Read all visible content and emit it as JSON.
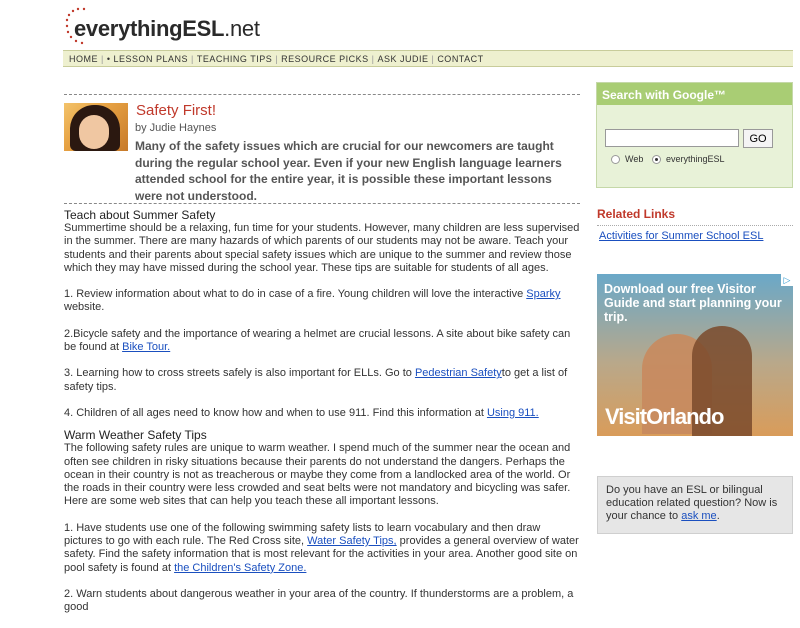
{
  "site": {
    "name_bold": "everythingESL",
    "name_suffix": ".net"
  },
  "nav": {
    "items": [
      "HOME",
      "• LESSON PLANS",
      "TEACHING TIPS",
      "RESOURCE PICKS",
      "ASK JUDIE",
      "CONTACT"
    ],
    "separator": "|"
  },
  "article": {
    "title": "Safety First!",
    "byline": "by Judie Haynes",
    "intro": "Many of the safety issues which are crucial for our newcomers are taught during the regular school year. Even if your new English language learners attended school for the entire year, it is possible these important lessons were not understood.",
    "sections": {
      "s1_heading": "Teach about Summer Safety",
      "s1_text": "Summertime should be a relaxing, fun time for your students. However, many children are less supervised in the summer. There are many hazards of which parents of our students may not be aware. Teach your students and their parents about special safety issues which are unique to the summer and review those which they may have missed during the school year. These tips are suitable for students of all ages.",
      "item1_pre": "1. Review information about what to do in case of a fire. Young children will love the interactive ",
      "item1_link": "Sparky ",
      "item1_post": "website.",
      "item2_pre": "2.Bicycle safety and the importance of wearing a helmet are crucial lessons. A site about bike safety can be found at ",
      "item2_link": "Bike Tour.",
      "item3_pre": "3. Learning how to cross streets safely is also important for ELLs. Go to ",
      "item3_link": "Pedestrian Safety",
      "item3_post": "to get a list of safety tips.",
      "item4_pre": "4. Children of all ages need to know how and when to use 911. Find this information at ",
      "item4_link": "Using 911.",
      "s2_heading": "Warm Weather Safety Tips",
      "s2_text": "The following safety rules are unique to warm weather. I spend much of the summer near the ocean and often see children in risky situations because their parents do not understand the dangers. Perhaps the ocean in their country is not as treacherous or maybe they come from a landlocked area of the world. Or the roads in their country were less crowded and seat belts were not mandatory and bicycling was safer. Here are some web sites that can help you teach these all important lessons.",
      "w1_pre": "1. Have students use one of the following swimming safety lists to learn vocabulary and then draw pictures to go with each rule. The Red Cross site, ",
      "w1_link": "Water Safety Tips,",
      "w1_mid": " provides a general overview of water safety. Find the safety information that is most relevant for the activities in your area. Another good site on pool safety is found at ",
      "w1_link2": "the Children's Safety Zone.",
      "w2_text": "2. Warn students about dangerous weather in your area of the country. If thunderstorms are a problem, a good"
    }
  },
  "sidebar": {
    "search": {
      "title": "Search with Google™",
      "input_value": "",
      "button": "GO",
      "option_web": "Web",
      "option_site": "everythingESL",
      "selected": "everythingESL"
    },
    "related": {
      "title": "Related Links",
      "links": [
        "Activities for Summer School ESL"
      ]
    },
    "ad": {
      "headline": "Download our free Visitor Guide and start planning your trip.",
      "brand": "VisitOrlando",
      "choices_icon": "ad-choices-icon"
    },
    "ask": {
      "text": "Do you have an ESL or bilingual education related question? Now is your chance to ",
      "link": "ask me",
      "post": "."
    }
  }
}
